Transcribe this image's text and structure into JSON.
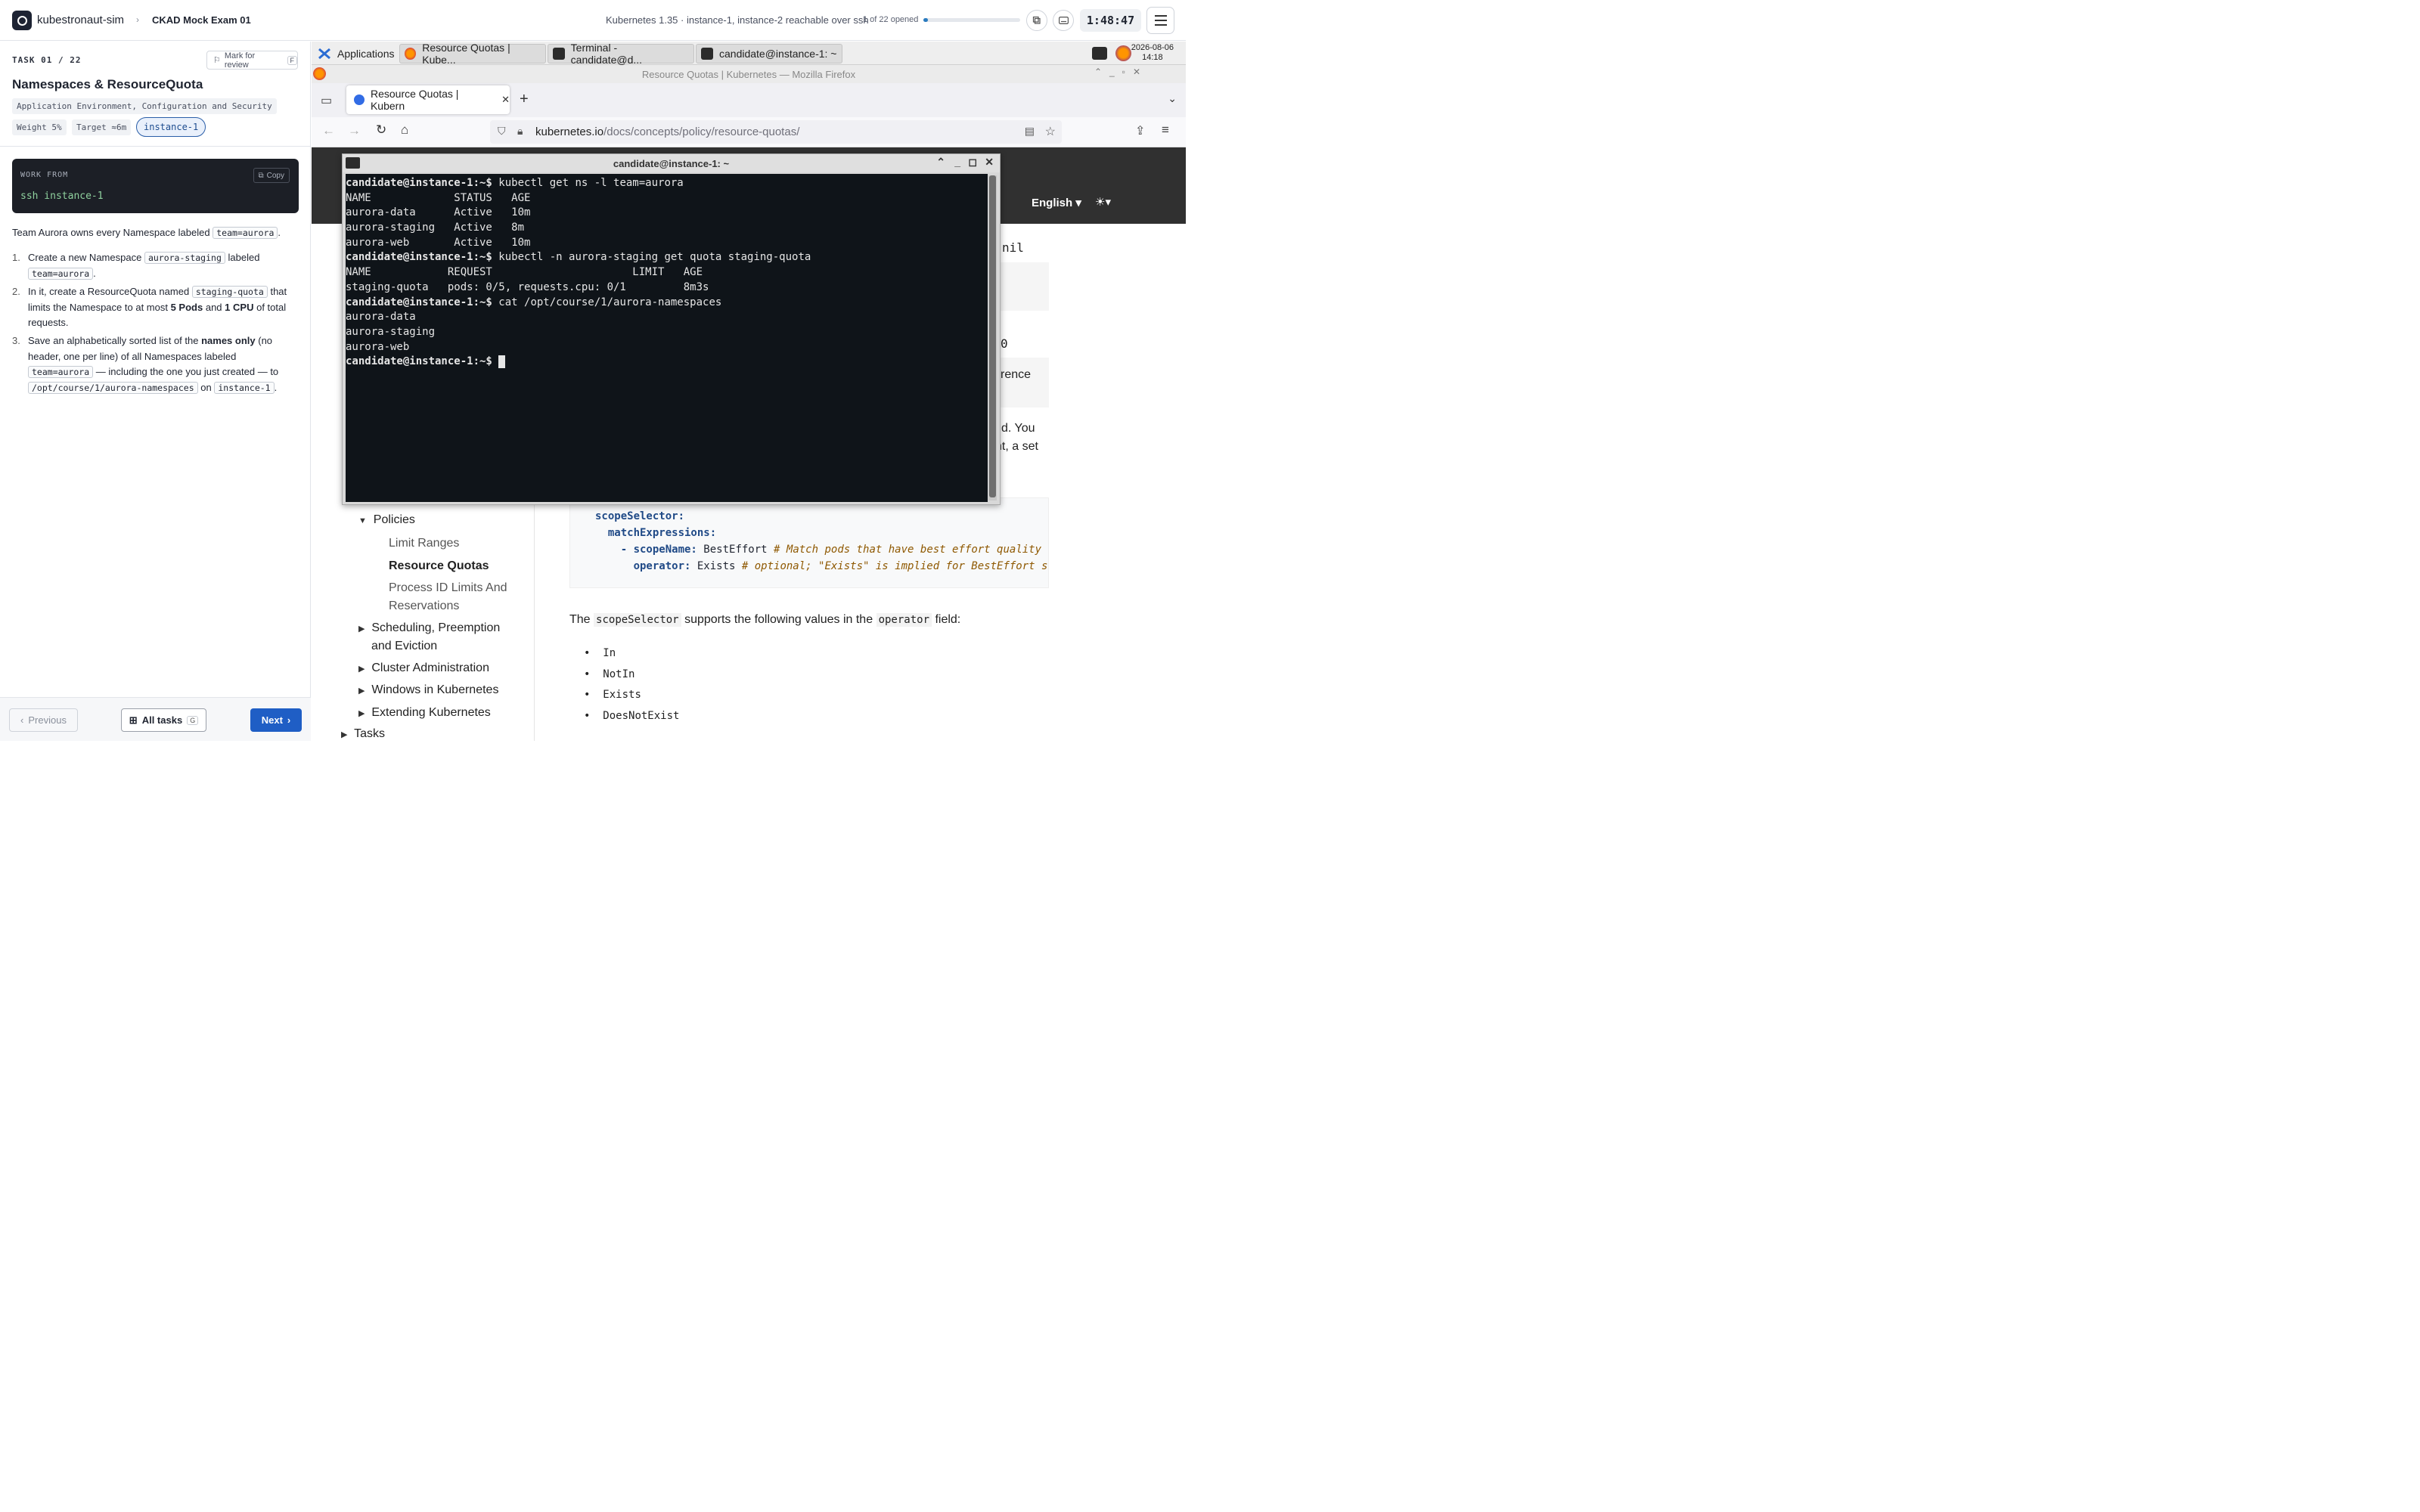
{
  "topbar": {
    "brand": "kubestronaut-sim",
    "exam": "CKAD Mock Exam 01",
    "env_info": "Kubernetes 1.35 · instance-1, instance-2 reachable over ssh",
    "opened": "1 of 22 opened",
    "progress": 0.045,
    "timer": "1:48:47"
  },
  "task": {
    "label": "TASK 01 / 22",
    "review_label": "Mark for review",
    "review_key": "F",
    "title": "Namespaces & ResourceQuota",
    "domain": "Application Environment, Configuration and Security",
    "weight": "Weight 5%",
    "target": "Target ≈6m",
    "instance": "instance-1",
    "work_from_label": "WORK FROM",
    "copy_label": "Copy",
    "work_cmd": "ssh instance-1",
    "intro_a": "Team Aurora owns every Namespace labeled",
    "intro_code": "team=aurora",
    "step1_a": "Create a new Namespace",
    "step1_code": "aurora-staging",
    "step1_b": "labeled",
    "step1_code2": "team=aurora",
    "step2_a": "In it, create a ResourceQuota named",
    "step2_code": "staging-quota",
    "step2_b": "that limits the Namespace to at most",
    "step2_bold1": "5 Pods",
    "step2_c": "and",
    "step2_bold2": "1 CPU",
    "step2_d": "of total requests.",
    "step3_a": "Save an alphabetically sorted list of the",
    "step3_bold": "names only",
    "step3_b": "(no header, one per line) of all Namespaces labeled",
    "step3_code": "team=aurora",
    "step3_c": "— including the one you just created — to",
    "step3_code2": "/opt/course/1/aurora-namespaces",
    "step3_d": "on",
    "step3_code3": "instance-1"
  },
  "nav": {
    "previous": "Previous",
    "all_tasks": "All tasks",
    "all_key": "G",
    "next": "Next"
  },
  "desktop": {
    "taskbar": {
      "applications": "Applications",
      "win1": "Resource Quotas | Kube...",
      "win2": "Terminal - candidate@d...",
      "win3": "candidate@instance-1: ~",
      "date": "2026-08-06",
      "time": "14:18"
    },
    "firefox": {
      "title": "Resource Quotas | Kubernetes — Mozilla Firefox",
      "tab": "Resource Quotas | Kubern",
      "url_host": "kubernetes.io",
      "url_path": "/docs/concepts/policy/resource-quotas/"
    },
    "page": {
      "lang": "English",
      "frag1": "nil",
      "frag2": "0",
      "frag3": "rence",
      "frag4": "d. You",
      "frag5": "nt, a set",
      "nav": [
        "Policies",
        "Limit Ranges",
        "Resource Quotas",
        "Process ID Limits And",
        "Reservations",
        "Scheduling, Preemption",
        "and Eviction",
        "Cluster Administration",
        "Windows in Kubernetes",
        "Extending Kubernetes",
        "Tasks"
      ],
      "code_l1": "scopeSelector:",
      "code_l2": "matchExpressions:",
      "code_l3a": "- scopeName:",
      "code_l3b": " BestEffort ",
      "code_l3c": "# Match pods that have best effort quality of",
      "code_l4a": "operator:",
      "code_l4b": " Exists ",
      "code_l4c": "# optional; \"Exists\" is implied for BestEffort sco",
      "para_a": "The",
      "para_code1": "scopeSelector",
      "para_b": "supports the following values in the",
      "para_code2": "operator",
      "para_c": "field:",
      "bullets": [
        "In",
        "NotIn",
        "Exists",
        "DoesNotExist"
      ]
    },
    "terminal": {
      "title": "candidate@instance-1: ~",
      "lines": [
        {
          "p": "candidate@instance-1:~$",
          "t": " kubectl get ns -l team=aurora"
        },
        {
          "p": "",
          "t": "NAME             STATUS   AGE"
        },
        {
          "p": "",
          "t": "aurora-data      Active   10m"
        },
        {
          "p": "",
          "t": "aurora-staging   Active   8m"
        },
        {
          "p": "",
          "t": "aurora-web       Active   10m"
        },
        {
          "p": "candidate@instance-1:~$",
          "t": " kubectl -n aurora-staging get quota staging-quota"
        },
        {
          "p": "",
          "t": "NAME            REQUEST                      LIMIT   AGE"
        },
        {
          "p": "",
          "t": "staging-quota   pods: 0/5, requests.cpu: 0/1         8m3s"
        },
        {
          "p": "candidate@instance-1:~$",
          "t": " cat /opt/course/1/aurora-namespaces"
        },
        {
          "p": "",
          "t": "aurora-data"
        },
        {
          "p": "",
          "t": "aurora-staging"
        },
        {
          "p": "",
          "t": "aurora-web"
        },
        {
          "p": "candidate@instance-1:~$",
          "t": " "
        }
      ]
    }
  }
}
